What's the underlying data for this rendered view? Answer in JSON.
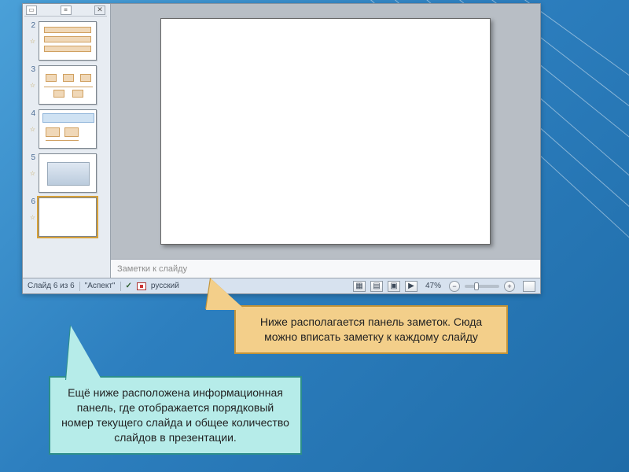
{
  "thumbs": [
    {
      "num": "2"
    },
    {
      "num": "3"
    },
    {
      "num": "4"
    },
    {
      "num": "5"
    },
    {
      "num": "6"
    }
  ],
  "notes_placeholder": "Заметки к слайду",
  "status": {
    "slide_counter": "Слайд 6 из 6",
    "theme": "\"Аспект\"",
    "language": "русский",
    "zoom_pct": "47%"
  },
  "callouts": {
    "yellow": "Ниже располагается панель заметок. Сюда можно вписать заметку к каждому слайду",
    "cyan": "Ещё ниже расположена информационная панель, где отображается порядковый номер текущего слайда и общее количество слайдов в презентации."
  },
  "icons": {
    "close_x": "✕",
    "star": "☆",
    "minus": "−",
    "plus": "+",
    "check": "✓"
  }
}
